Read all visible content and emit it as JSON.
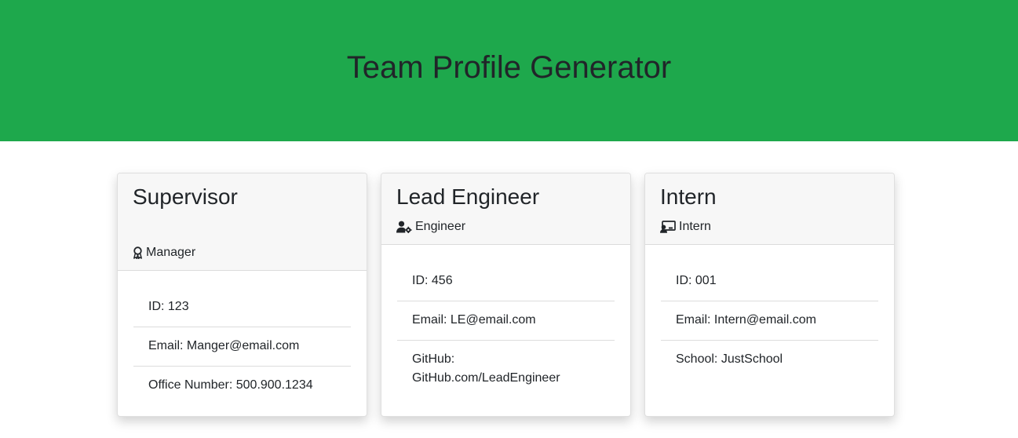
{
  "header": {
    "title": "Team Profile Generator"
  },
  "colors": {
    "header_background": "#1ea84c",
    "card_header_background": "#f7f7f7",
    "text": "#212529"
  },
  "cards": [
    {
      "name": "Supervisor",
      "role": "Manager",
      "role_icon": "award-icon",
      "details": [
        "ID: 123",
        "Email: Manger@email.com",
        "Office Number: 500.900.1234"
      ]
    },
    {
      "name": "Lead Engineer",
      "role": "Engineer",
      "role_icon": "user-gear-icon",
      "details": [
        "ID: 456",
        "Email: LE@email.com",
        "GitHub: GitHub.com/LeadEngineer"
      ]
    },
    {
      "name": "Intern",
      "role": "Intern",
      "role_icon": "student-board-icon",
      "details": [
        "ID: 001",
        "Email: Intern@email.com",
        "School: JustSchool"
      ]
    }
  ]
}
